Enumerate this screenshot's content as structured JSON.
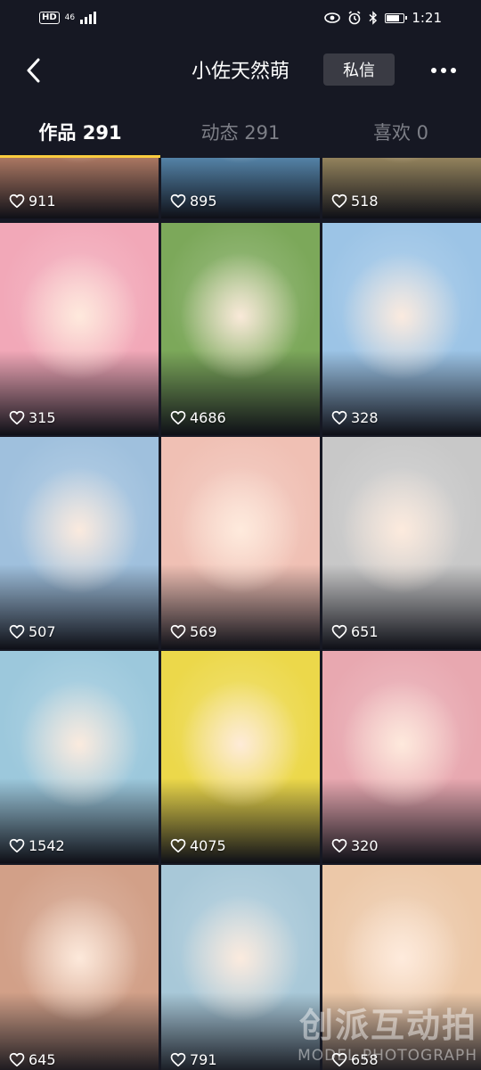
{
  "status_bar": {
    "hd": "HD",
    "net": "46",
    "time": "1:21"
  },
  "header": {
    "title": "小佐天然萌",
    "dm_label": "私信"
  },
  "tabs": [
    {
      "label": "作品 291",
      "active": true
    },
    {
      "label": "动态 291",
      "active": false
    },
    {
      "label": "喜欢 0",
      "active": false
    }
  ],
  "grid": {
    "posts": [
      {
        "likes": "911",
        "bg": "#e8a080"
      },
      {
        "likes": "895",
        "bg": "#6fb0e0"
      },
      {
        "likes": "518",
        "bg": "#c8b078"
      },
      {
        "likes": "315",
        "bg": "#f2a8b8"
      },
      {
        "likes": "4686",
        "bg": "#7ca85a"
      },
      {
        "likes": "328",
        "bg": "#9cc4e6"
      },
      {
        "likes": "507",
        "bg": "#9fc0dd"
      },
      {
        "likes": "569",
        "bg": "#f0c0b4"
      },
      {
        "likes": "651",
        "bg": "#c8c8c8"
      },
      {
        "likes": "1542",
        "bg": "#9cc8dc"
      },
      {
        "likes": "4075",
        "bg": "#ecd84a"
      },
      {
        "likes": "320",
        "bg": "#e8a8b0"
      },
      {
        "likes": "645",
        "bg": "#d2a088"
      },
      {
        "likes": "791",
        "bg": "#a8c8d8"
      },
      {
        "likes": "658",
        "bg": "#ecc8a8"
      }
    ]
  },
  "watermark": {
    "line1": "创派互动拍",
    "line2": "MODEL PHOTOGRAPH"
  }
}
